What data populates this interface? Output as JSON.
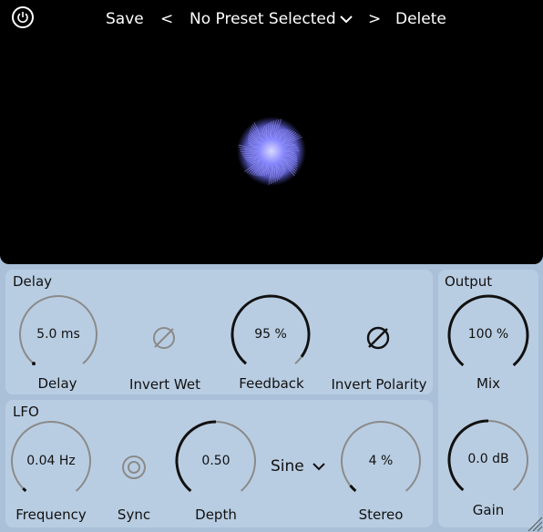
{
  "toolbar": {
    "save": "Save",
    "prev": "<",
    "preset": "No Preset Selected",
    "next": ">",
    "delete": "Delete"
  },
  "delay": {
    "title": "Delay",
    "delay_knob": {
      "value": "5.0 ms",
      "label": "Delay",
      "level": 0.0
    },
    "invert_wet": {
      "label": "Invert Wet",
      "active": false
    },
    "feedback_knob": {
      "value": "95 %",
      "label": "Feedback",
      "level": 0.95
    },
    "invert_polarity": {
      "label": "Invert Polarity",
      "active": true
    }
  },
  "lfo": {
    "title": "LFO",
    "frequency_knob": {
      "value": "0.04 Hz",
      "label": "Frequency",
      "level": 0.02
    },
    "sync": {
      "label": "Sync"
    },
    "depth_knob": {
      "value": "0.50",
      "label": "Depth",
      "level": 0.5
    },
    "shape": {
      "value": "Sine"
    },
    "stereo_knob": {
      "value": "4 %",
      "label": "Stereo",
      "level": 0.04
    }
  },
  "output": {
    "title": "Output",
    "mix_knob": {
      "value": "100 %",
      "label": "Mix",
      "level": 1.0
    },
    "gain_knob": {
      "value": "0.0 dB",
      "label": "Gain",
      "level": 0.5
    }
  },
  "colors": {
    "background": "#a9c0d8",
    "panel": "#b9cde2",
    "display": "#000000",
    "knob_active": "#111111",
    "knob_track": "#8a8a8a",
    "viz": "#8f8fff"
  }
}
